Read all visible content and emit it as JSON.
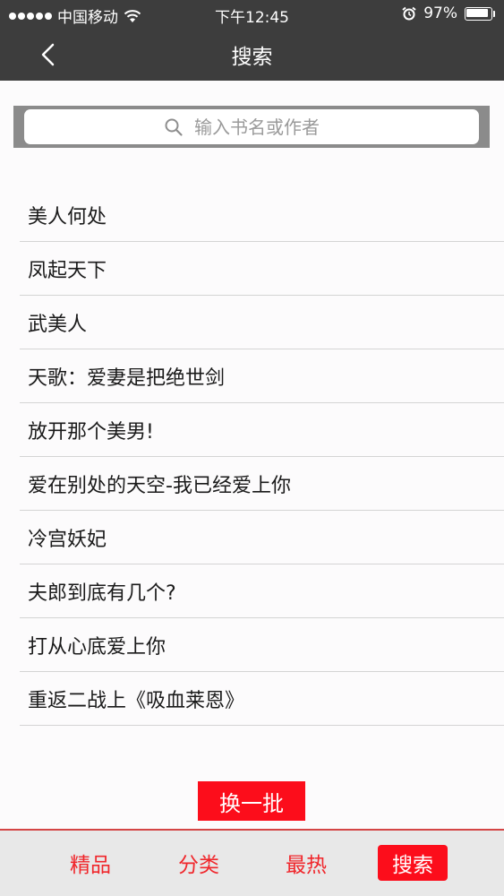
{
  "status_bar": {
    "carrier": "中国移动",
    "time": "下午12:45",
    "battery_text": "97%",
    "battery_level": 0.97,
    "signal_dots": 5,
    "icons": [
      "wifi-icon",
      "alarm-icon",
      "battery-icon"
    ]
  },
  "nav": {
    "title": "搜索",
    "back_icon": "chevron-left-icon"
  },
  "search": {
    "placeholder": "输入书名或作者",
    "value": "",
    "icon": "search-icon"
  },
  "books": [
    "美人何处",
    "凤起天下",
    "武美人",
    "天歌：爱妻是把绝世剑",
    "放开那个美男!",
    "爱在别处的天空-我已经爱上你",
    "冷宫妖妃",
    "夫郎到底有几个?",
    "打从心底爱上你",
    "重返二战上《吸血莱恩》"
  ],
  "refresh_label": "换一批",
  "tabs": [
    {
      "label": "精品",
      "active": false
    },
    {
      "label": "分类",
      "active": false
    },
    {
      "label": "最热",
      "active": false
    },
    {
      "label": "搜索",
      "active": true
    }
  ],
  "colors": {
    "header_bg": "#3d3d3d",
    "accent": "#fc0d1b",
    "tab_text": "#f0262b",
    "tabbar_bg": "#e8e8e8"
  }
}
